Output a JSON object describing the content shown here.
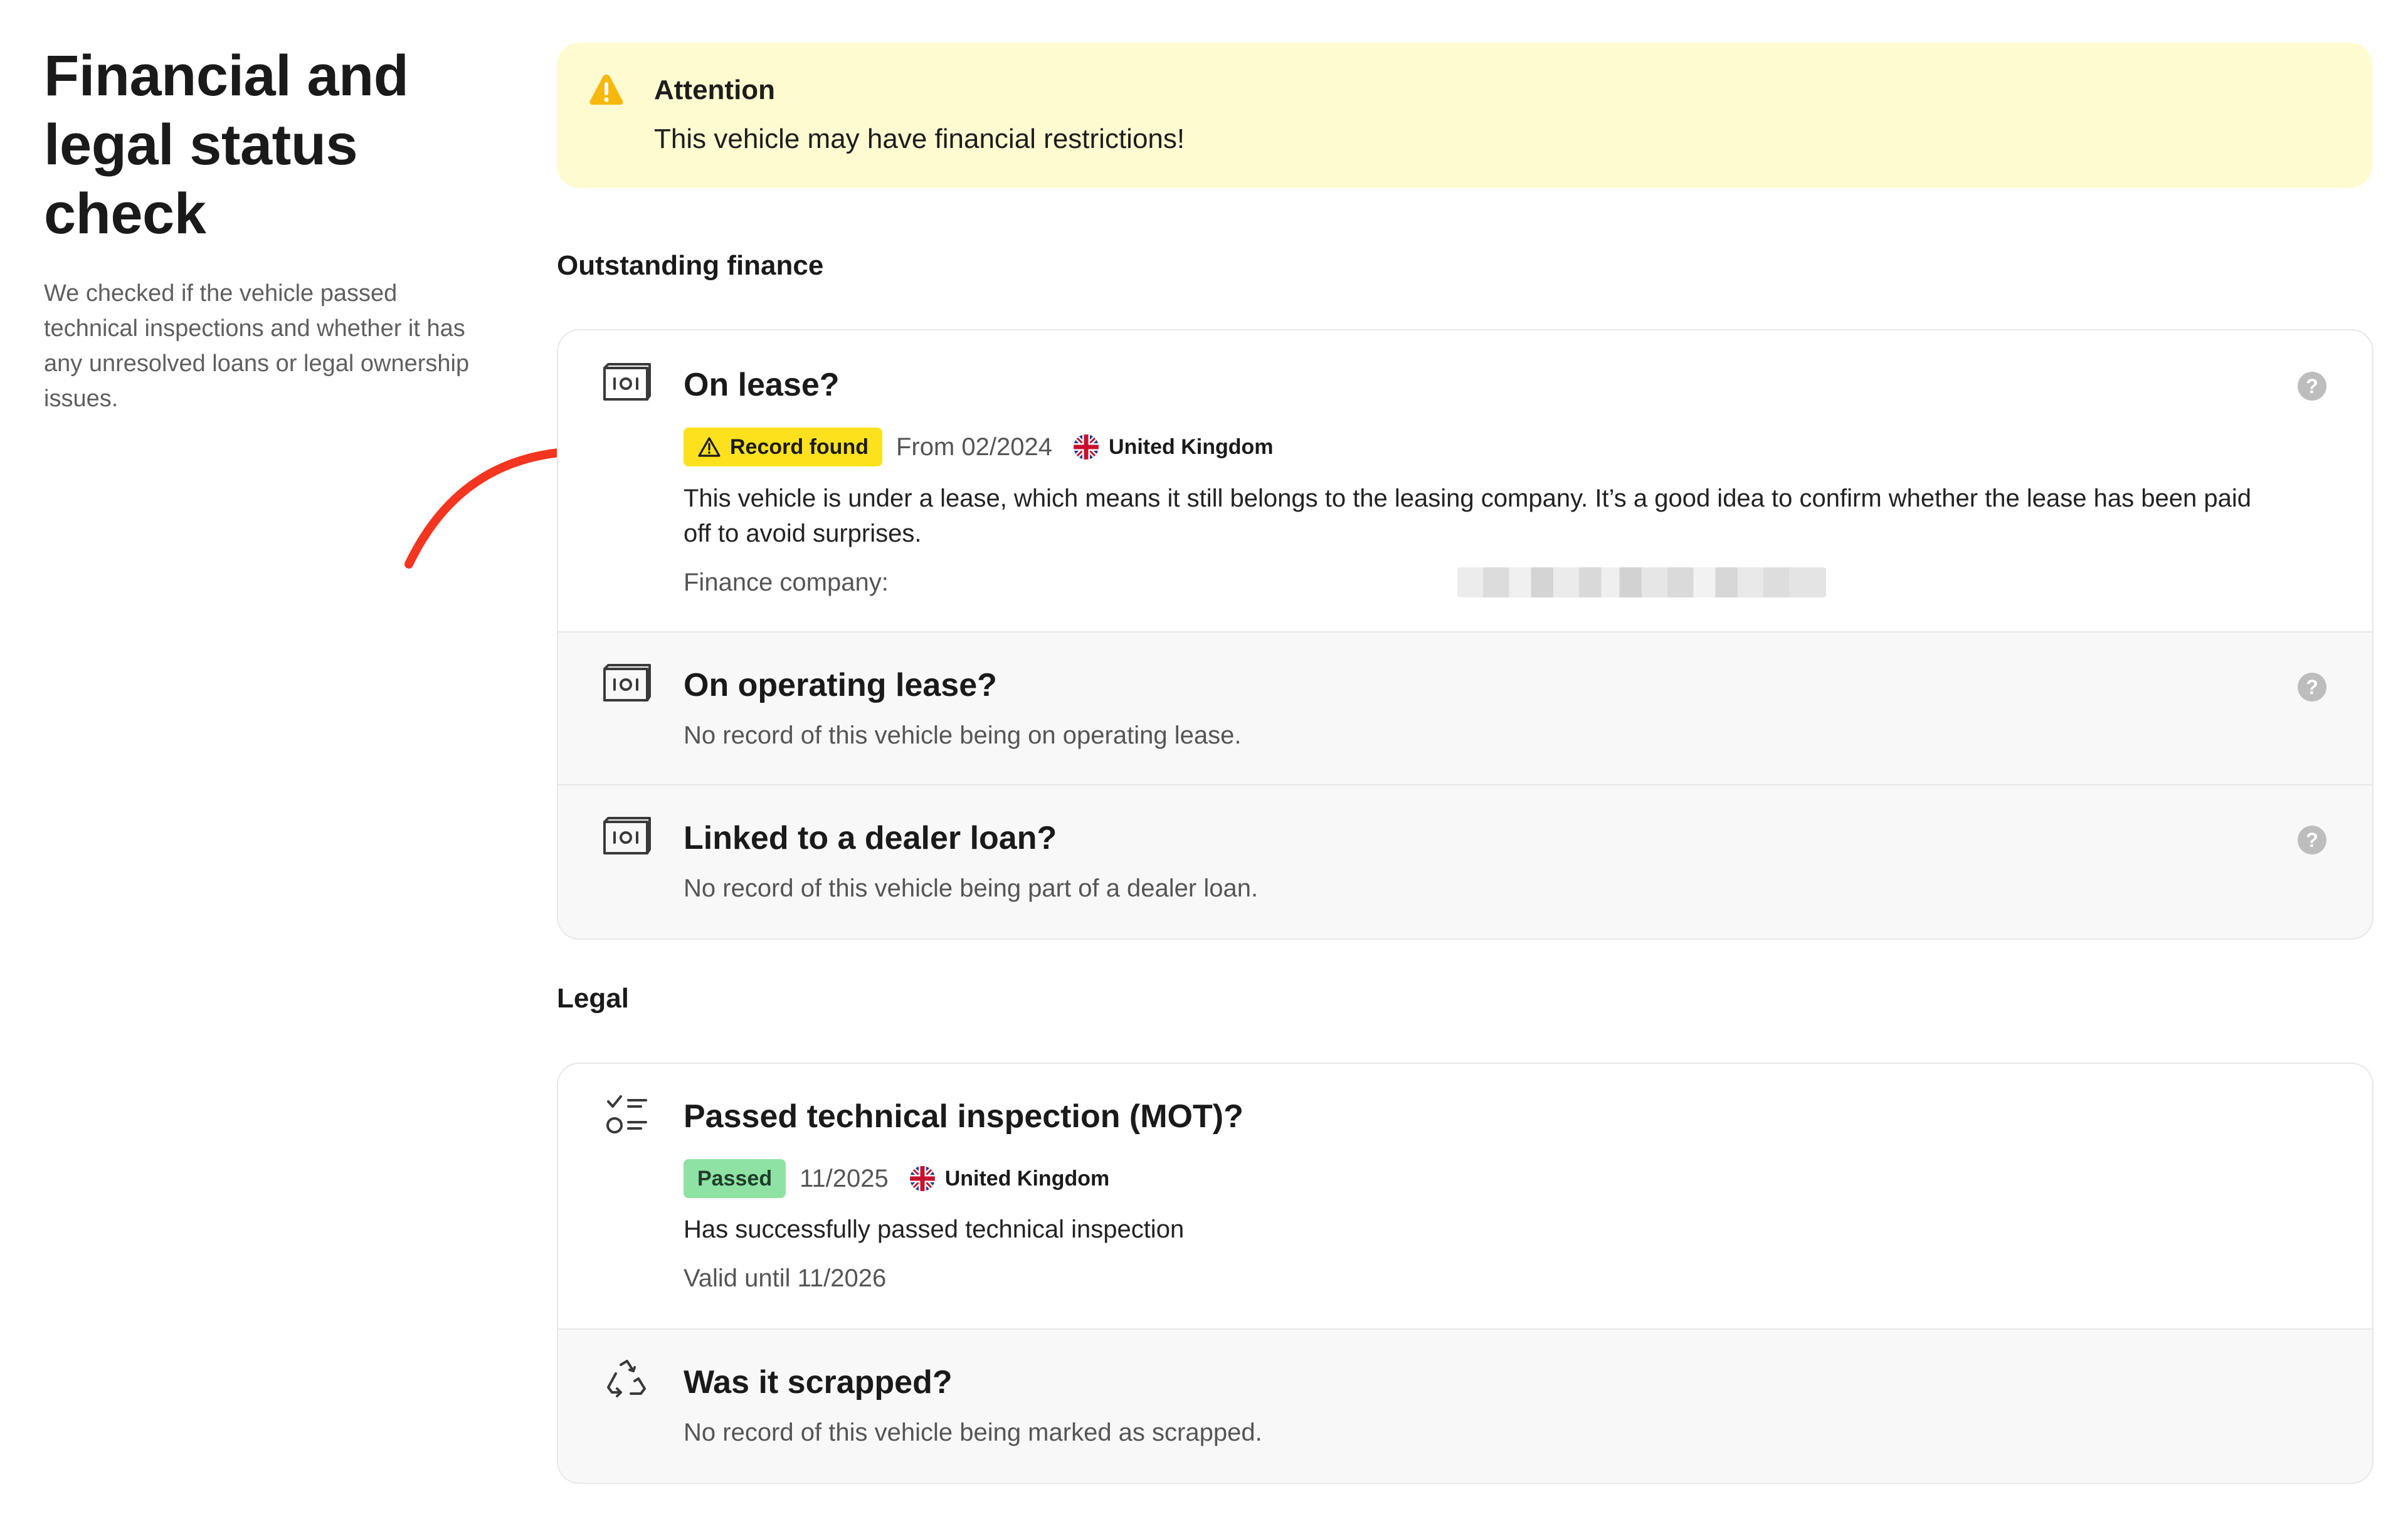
{
  "left": {
    "title": "Financial and legal status check",
    "description": "We checked if the vehicle passed technical inspections and whether it has any unresolved loans or legal ownership issues."
  },
  "attention": {
    "title": "Attention",
    "text": "This vehicle may have financial restrictions!"
  },
  "finance": {
    "heading": "Outstanding finance",
    "lease": {
      "title": "On lease?",
      "badge": "Record found",
      "date": "From 02/2024",
      "country": "United Kingdom",
      "description_line1": "This vehicle is under a lease, which means it still belongs to the leasing company. It’s a good idea to confirm whether the lease has been paid",
      "description_line2": "off to avoid surprises.",
      "company_label": "Finance company:"
    },
    "operating_lease": {
      "title": "On operating lease?",
      "text": "No record of this vehicle being on operating lease."
    },
    "dealer_loan": {
      "title": "Linked to a dealer loan?",
      "text": "No record of this vehicle being part of a dealer loan."
    }
  },
  "legal": {
    "heading": "Legal",
    "mot": {
      "title": "Passed technical inspection (MOT)?",
      "badge": "Passed",
      "date": "11/2025",
      "country": "United Kingdom",
      "text": "Has successfully passed technical inspection",
      "valid": "Valid until 11/2026"
    },
    "scrapped": {
      "title": "Was it scrapped?",
      "text": "No record of this vehicle being marked as scrapped."
    }
  },
  "help_symbol": "?",
  "colors": {
    "attention_bg": "#fefbd1",
    "warning_badge": "#fde11d",
    "passed_badge": "#8ee2a3",
    "annotation_arrow": "#f4351f",
    "warning_icon": "#f6b90b"
  },
  "icons": {
    "attention": "warning-triangle-icon",
    "finance_rows": "banknote-icon",
    "mot": "checklist-icon",
    "scrapped": "recycle-icon",
    "help": "question-circle-icon",
    "flag": "uk-flag-icon"
  }
}
